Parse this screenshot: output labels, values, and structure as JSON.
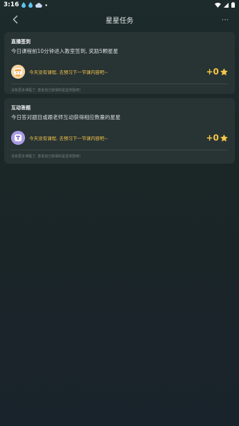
{
  "status_bar": {
    "time": "3:16"
  },
  "nav": {
    "title": "星星任务",
    "more_label": "···"
  },
  "cards": [
    {
      "title": "直播签到",
      "description": "今日课程前10分钟进入教室签到, 奖励5颗星星",
      "task_text": "今天没有课程, 去预习下一节课内容吧~",
      "reward": "+0",
      "note": "没有更多课程了, 查看自己获得的星星奖励吧!"
    },
    {
      "title": "互动答题",
      "description": "今日答对题目或跟老师互动获得相应数量的星星",
      "task_text": "今天没有课程, 去预习下一节课内容吧~",
      "reward": "+0",
      "note": "没有更多课程了, 查看自己获得的星星奖励吧!"
    }
  ],
  "colors": {
    "accent": "#f6c846",
    "card_bg": "#283334",
    "page_bg": "#1b2627"
  },
  "icons": {
    "back": "chevron-left-icon",
    "more": "more-icon",
    "star": "star-icon"
  }
}
